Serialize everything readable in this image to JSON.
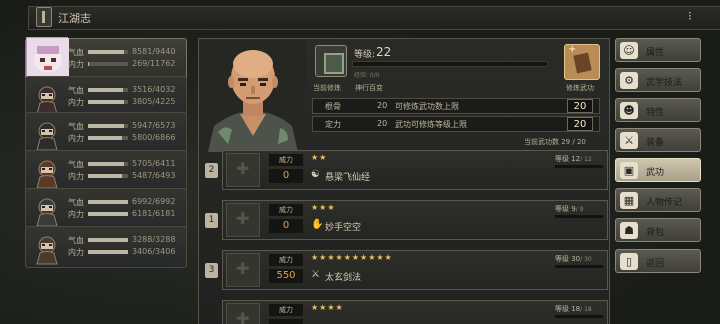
{
  "window": {
    "title": "江湖志",
    "menu_glyph": "⁝"
  },
  "party": [
    {
      "qi": 8581,
      "qi_max": 9440,
      "neili": 269,
      "neili_max": 11762,
      "selected": true
    },
    {
      "qi": 3516,
      "qi_max": 4032,
      "neili": 3805,
      "neili_max": 4225
    },
    {
      "qi": 5947,
      "qi_max": 6573,
      "neili": 5800,
      "neili_max": 6866
    },
    {
      "qi": 5705,
      "qi_max": 6411,
      "neili": 5487,
      "neili_max": 6493
    },
    {
      "qi": 6992,
      "qi_max": 6992,
      "neili": 6181,
      "neili_max": 6181
    },
    {
      "qi": 3288,
      "qi_max": 3288,
      "neili": 3406,
      "neili_max": 3406
    }
  ],
  "labels": {
    "qi": "气血",
    "neili": "内力"
  },
  "hero": {
    "level_label": "等级:",
    "level": "22",
    "xp_text": "经验: 0/0",
    "current_label": "当前修炼",
    "current_name": "神行百变",
    "learn_label": "修炼武功",
    "learn_plus": "+",
    "attrs": [
      {
        "name": "根骨",
        "value": "20",
        "desc": "可修炼武功数上限",
        "big": "20"
      },
      {
        "name": "定力",
        "value": "20",
        "desc": "武功可修炼等级上限",
        "big": "20"
      }
    ],
    "count_text": "当前武功数    29 / 20"
  },
  "skills": [
    {
      "slot": "2",
      "power_label": "威力",
      "stars": "★★",
      "power": "0",
      "icon": "☯",
      "name": "悬梁飞仙经",
      "level_text": "等级 12",
      "level_max": "/ 12"
    },
    {
      "slot": "1",
      "power_label": "威力",
      "stars": "★★★",
      "power": "0",
      "icon": "✋",
      "name": "妙手空空",
      "level_text": "等级 9",
      "level_max": "/ 9"
    },
    {
      "slot": "3",
      "power_label": "威力",
      "stars": "★★★★★★★★★★",
      "power": "550",
      "icon": "⚔",
      "name": "太玄剑法",
      "level_text": "等级 30",
      "level_max": "/ 30"
    },
    {
      "slot": "",
      "power_label": "威力",
      "stars": "★★★★",
      "power": "",
      "icon": "",
      "name": "",
      "level_text": "等级 18",
      "level_max": "/ 18"
    }
  ],
  "tabs": [
    {
      "label": "属性",
      "icon": "☺"
    },
    {
      "label": "武学技法",
      "icon": "⚙"
    },
    {
      "label": "特性",
      "icon": "☻"
    },
    {
      "label": "装备",
      "icon": "⚔"
    },
    {
      "label": "武功",
      "icon": "▣",
      "active": true
    },
    {
      "label": "人物传记",
      "icon": "▦"
    },
    {
      "label": "背包",
      "icon": "☗"
    },
    {
      "label": "返回",
      "icon": "▯"
    }
  ]
}
